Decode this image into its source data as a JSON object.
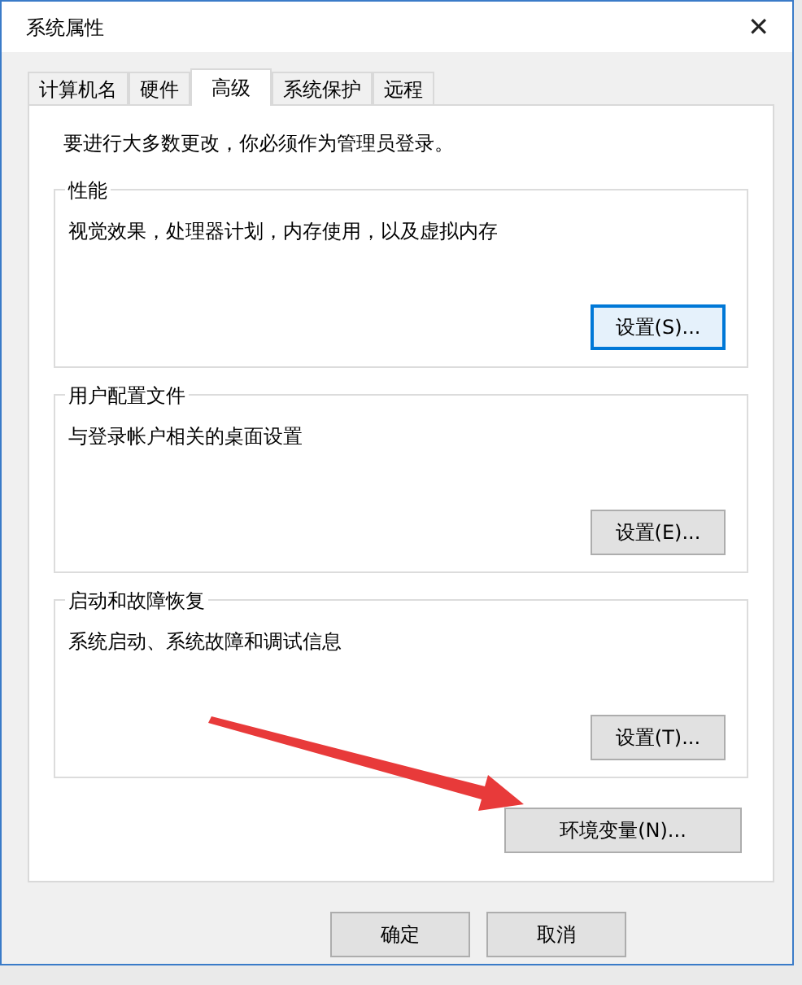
{
  "window": {
    "title": "系统属性",
    "close": "✕"
  },
  "tabs": [
    {
      "label": "计算机名",
      "selected": false
    },
    {
      "label": "硬件",
      "selected": false
    },
    {
      "label": "高级",
      "selected": true
    },
    {
      "label": "系统保护",
      "selected": false
    },
    {
      "label": "远程",
      "selected": false
    }
  ],
  "notice": "要进行大多数更改，你必须作为管理员登录。",
  "groups": [
    {
      "title": "性能",
      "description": "视觉效果，处理器计划，内存使用，以及虚拟内存",
      "button": "设置(S)...",
      "focused": true
    },
    {
      "title": "用户配置文件",
      "description": "与登录帐户相关的桌面设置",
      "button": "设置(E)...",
      "focused": false
    },
    {
      "title": "启动和故障恢复",
      "description": "系统启动、系统故障和调试信息",
      "button": "设置(T)...",
      "focused": false
    }
  ],
  "env_button": "环境变量(N)...",
  "buttons": [
    "确定",
    "取消"
  ]
}
